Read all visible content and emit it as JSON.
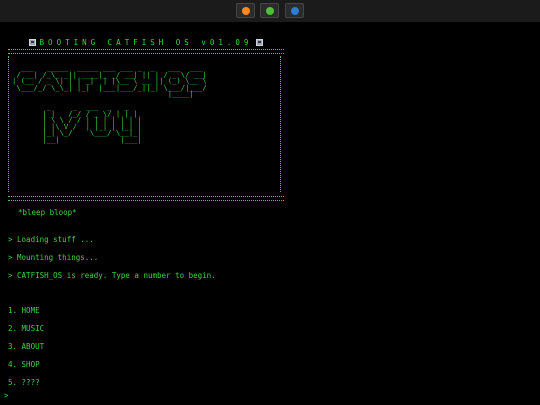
{
  "window_controls": [
    {
      "name": "orange",
      "color": "#ff8a1c"
    },
    {
      "name": "green",
      "color": "#4fbf3a"
    },
    {
      "name": "blue",
      "color": "#2c7bd6"
    }
  ],
  "boot": {
    "title": "BOOTING CATFISH OS v01.09",
    "ascii_logo": "  ___   _____  _____ ___ ___ _  _   ___  ___ \n / __| /_\\_ _|| ____|_ _/ __| || | / _ \\/ __|\n| (__ / _ \\| | | _|  | |\\__ \\ __ || (_) \\__ \\\n \\___/_/ \\_\\_| |_|  |___|___/_||_| \\___/|___/\n                                    |____|\n\n        _     _  ___  _   _\n       | |   /_/ / _ \\/ | | |\n       | \\ \\ / / | | | | | | |\n       | |\\ V /  | |_| | |_| |\n       |_| \\_/    \\___/ \\__|_|\n       |__|              |___|",
    "bleep": "*bleep bloop*"
  },
  "log": [
    "> Loading stuff ...",
    "> Mounting things...",
    "> CATFISH_OS is ready. Type a number to begin."
  ],
  "menu": [
    "1. HOME",
    "2. MUSIC",
    "3. ABOUT",
    "4. SHOP",
    "5. ????"
  ],
  "prompt": ">"
}
